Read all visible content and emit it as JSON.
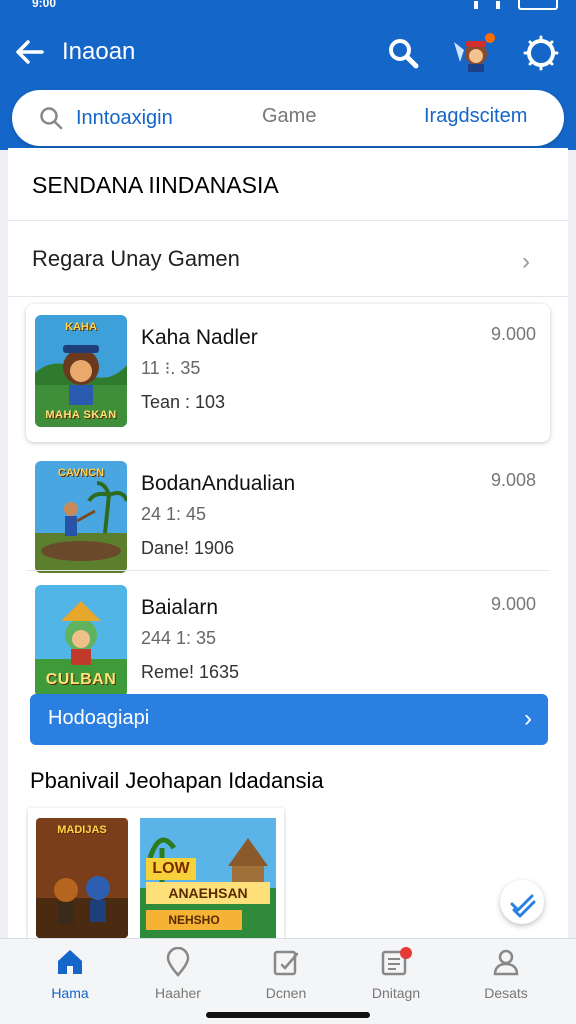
{
  "header": {
    "title": "Inaoan",
    "icons": [
      "back-arrow-icon",
      "search-icon",
      "mascot-avatar",
      "settings-ring-icon"
    ]
  },
  "tabs": [
    {
      "label": "Inntoaxigin",
      "icon": "search-icon"
    },
    {
      "label": "Game"
    },
    {
      "label": "Iragdscitem"
    }
  ],
  "section": {
    "title": "SENDANA IINDANASIA",
    "row_title": "Regara Unay Gamen"
  },
  "games": [
    {
      "name": "Kaha Nadler",
      "time": "11 ⁝. 35",
      "meta": "Tean : 103",
      "value": "9.000",
      "thumb_top": "KAHA",
      "thumb_label": "MAHA SKAN"
    },
    {
      "name": "BodanAndualian",
      "time": "24 1: 45",
      "meta": "Dane! 1906",
      "value": "9.008",
      "thumb_top": "CAVNCN",
      "thumb_label": ""
    },
    {
      "name": "Baialarn",
      "time": "244 1: 35",
      "meta": "Reme! 1635",
      "value": "9.000",
      "thumb_top": "",
      "thumb_label": "CULBAN"
    }
  ],
  "action_button": {
    "label": "Hodoagiapi"
  },
  "section2": {
    "title": "Pbanivail Jeohapan Idadansia",
    "tiles": [
      {
        "top": "MADIJAS",
        "bottom": ""
      },
      {
        "top": "LOW",
        "middle": "ANAEHSAN",
        "bottom": "NEHSHO"
      }
    ]
  },
  "bottom_nav": [
    {
      "label": "Hama",
      "icon": "home-icon",
      "active": true
    },
    {
      "label": "Haaher",
      "icon": "location-pin-icon",
      "active": false
    },
    {
      "label": "Dcnen",
      "icon": "edit-note-icon",
      "active": false
    },
    {
      "label": "Dnitagn",
      "icon": "notes-badge-icon",
      "active": false,
      "badge": "1"
    },
    {
      "label": "Desats",
      "icon": "profile-icon",
      "active": false
    }
  ],
  "colors": {
    "primary": "#1466c8",
    "button": "#2b7fe0",
    "badge": "#e53935"
  }
}
